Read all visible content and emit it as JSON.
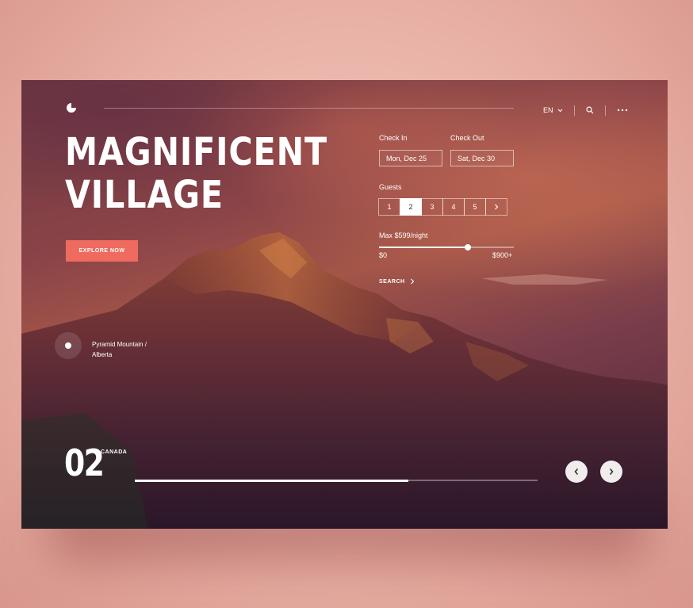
{
  "hero": {
    "title_line1": "MAGNIFICENT",
    "title_line2": "VILLAGE",
    "explore_label": "EXPLORE NOW"
  },
  "topbar": {
    "language": "EN",
    "icons": [
      "logo-icon",
      "chevron-down-icon",
      "search-icon",
      "more-icon"
    ]
  },
  "booking": {
    "check_in_label": "Check In",
    "check_in_value": "Mon, Dec 25",
    "check_out_label": "Check Out",
    "check_out_value": "Sat, Dec 30",
    "guests_label": "Guests",
    "guest_options": [
      "1",
      "2",
      "3",
      "4",
      "5"
    ],
    "guest_selected": "2",
    "price_label": "Max $599/night",
    "price_min": "$0",
    "price_max": "$900+",
    "price_level": 0.66,
    "search_label": "SEARCH"
  },
  "location": {
    "line1": "Pyramid Mountain /",
    "line2": "Alberta"
  },
  "slide": {
    "number": "02",
    "country": "CANADA",
    "progress": 0.68
  },
  "colors": {
    "accent": "#ef6a5f",
    "text": "#ffffff",
    "nav_button": "#f1eded"
  }
}
